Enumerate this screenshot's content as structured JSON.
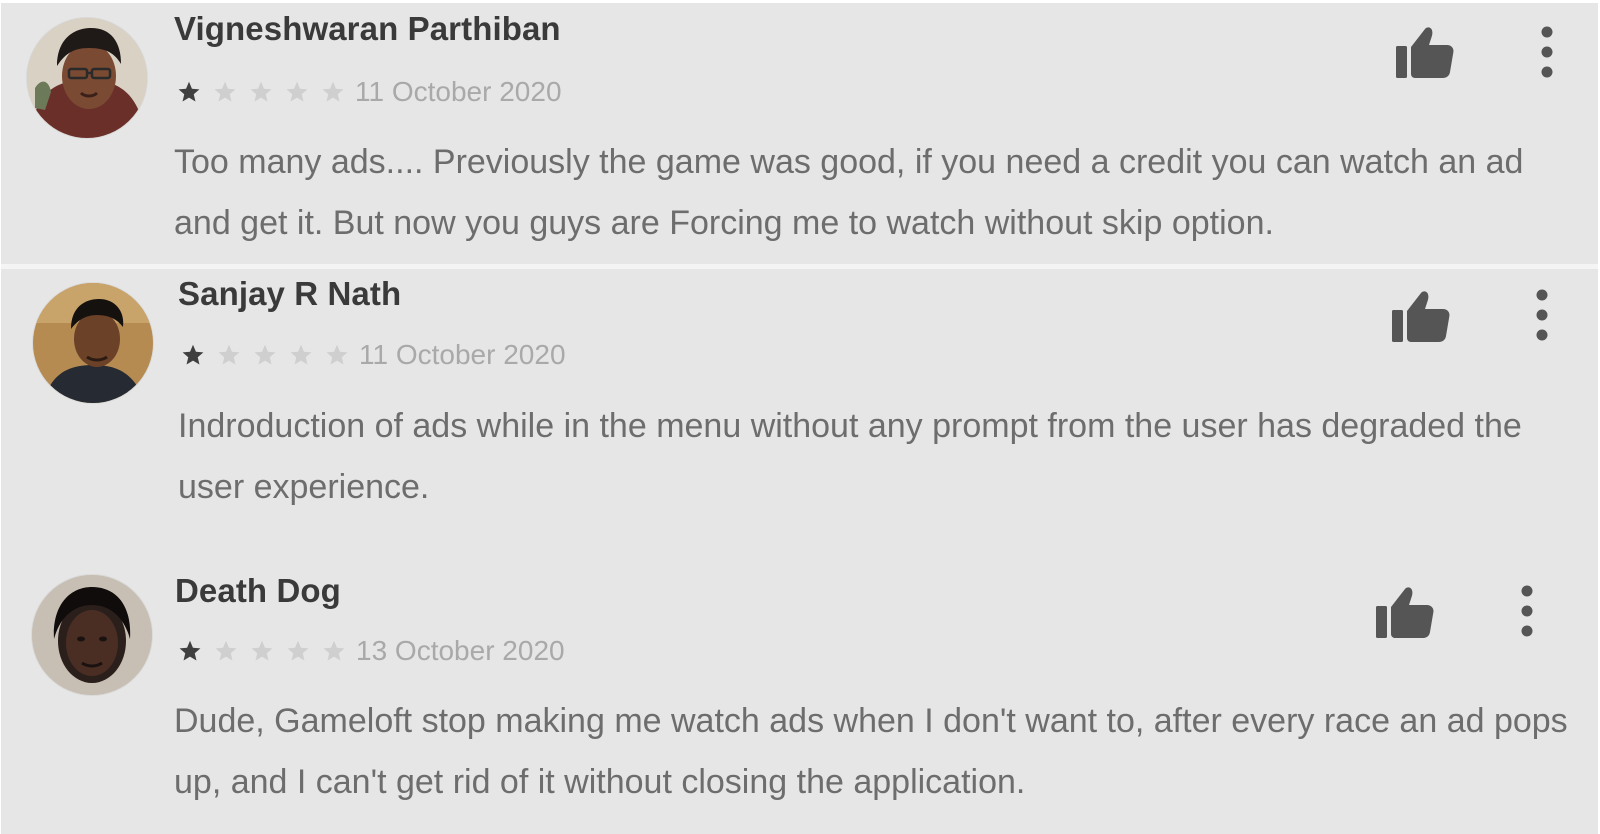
{
  "colors": {
    "background": "#e6e6e6",
    "name_text": "#3a3a3a",
    "body_text": "#6d6d6d",
    "date_text": "#a9a9a9",
    "star_filled": "#3f3f3f",
    "star_empty": "#cfcfcf",
    "icon": "#555555"
  },
  "reviews": [
    {
      "author": "Vigneshwaran Parthiban",
      "rating": 1,
      "max_rating": 5,
      "date": "11 October 2020",
      "text": "Too many ads.... Previously the game was good, if you need a credit you can watch an ad and get it. But now you guys are Forcing me to watch without skip option.",
      "avatar_icon": "user-avatar-photo",
      "helpful_icon": "thumbs-up-icon",
      "menu_icon": "more-vertical-icon"
    },
    {
      "author": "Sanjay R Nath",
      "rating": 1,
      "max_rating": 5,
      "date": "11 October 2020",
      "text": "Indroduction of ads while in the menu without any prompt from the user has degraded the user experience.",
      "avatar_icon": "user-avatar-photo",
      "helpful_icon": "thumbs-up-icon",
      "menu_icon": "more-vertical-icon"
    },
    {
      "author": "Death Dog",
      "rating": 1,
      "max_rating": 5,
      "date": "13 October 2020",
      "text": "Dude, Gameloft stop making me watch ads when I don't want to, after every race an ad pops up, and I can't get rid of it without closing the application.",
      "avatar_icon": "user-avatar-photo",
      "helpful_icon": "thumbs-up-icon",
      "menu_icon": "more-vertical-icon"
    }
  ]
}
